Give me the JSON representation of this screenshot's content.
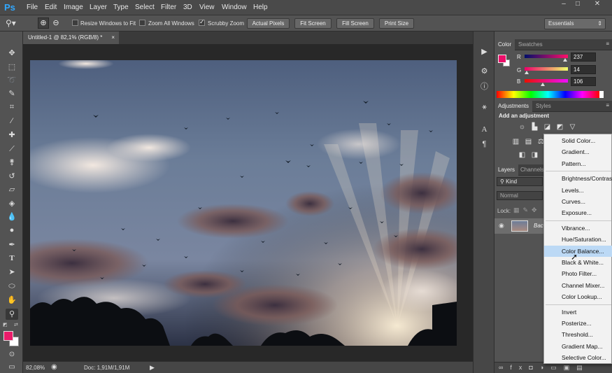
{
  "app": {
    "logo": "Ps"
  },
  "menu": {
    "items": [
      "File",
      "Edit",
      "Image",
      "Layer",
      "Type",
      "Select",
      "Filter",
      "3D",
      "View",
      "Window",
      "Help"
    ]
  },
  "window_controls": [
    "minimize-icon",
    "maximize-icon",
    "close-icon"
  ],
  "options_bar": {
    "checkboxes": [
      {
        "label": "Resize Windows to Fit",
        "checked": false
      },
      {
        "label": "Zoom All Windows",
        "checked": false
      },
      {
        "label": "Scrubby Zoom",
        "checked": true
      }
    ],
    "buttons": [
      "Actual Pixels",
      "Fit Screen",
      "Fill Screen",
      "Print Size"
    ],
    "workspace": "Essentials"
  },
  "toolbar": {
    "tools": [
      "move-tool",
      "marquee-tool",
      "lasso-tool",
      "quick-selection-tool",
      "crop-tool",
      "eyedropper-tool",
      "healing-brush-tool",
      "brush-tool",
      "clone-stamp-tool",
      "history-brush-tool",
      "eraser-tool",
      "paint-bucket-tool",
      "blur-tool",
      "dodge-tool",
      "pen-tool",
      "type-tool",
      "path-selection-tool",
      "shape-tool",
      "hand-tool",
      "zoom-tool"
    ],
    "active_tool": "zoom-tool",
    "foreground_color": "#ec1c6a",
    "background_color": "#ffffff"
  },
  "document": {
    "tab_title": "Untitled-1 @ 82,1% (RGB/8) *",
    "close_glyph": "×",
    "status": {
      "zoom": "82,08%",
      "doc": "Doc: 1,91M/1,91M"
    }
  },
  "color_panel": {
    "tabs": [
      "Color",
      "Swatches"
    ],
    "channels": [
      {
        "label": "R",
        "value": "237",
        "fraction": 0.929
      },
      {
        "label": "G",
        "value": "14",
        "fraction": 0.055
      },
      {
        "label": "B",
        "value": "106",
        "fraction": 0.416
      }
    ],
    "swatch": "#ed0e6a"
  },
  "adjustments_panel": {
    "tabs": [
      "Adjustments",
      "Styles"
    ],
    "heading": "Add an adjustment"
  },
  "layers_panel": {
    "tabs": [
      "Layers",
      "Channels"
    ],
    "kind": "Kind",
    "blend_mode": "Normal",
    "lock_label": "Lock:",
    "layer_name": "Bac"
  },
  "adjustment_menu": {
    "highlighted": "Color Balance...",
    "groups": [
      [
        "Solid Color...",
        "Gradient...",
        "Pattern..."
      ],
      [
        "Brightness/Contrast...",
        "Levels...",
        "Curves...",
        "Exposure..."
      ],
      [
        "Vibrance...",
        "Hue/Saturation...",
        "Color Balance...",
        "Black & White...",
        "Photo Filter...",
        "Channel Mixer...",
        "Color Lookup..."
      ],
      [
        "Invert",
        "Posterize...",
        "Threshold...",
        "Gradient Map...",
        "Selective Color..."
      ]
    ]
  }
}
